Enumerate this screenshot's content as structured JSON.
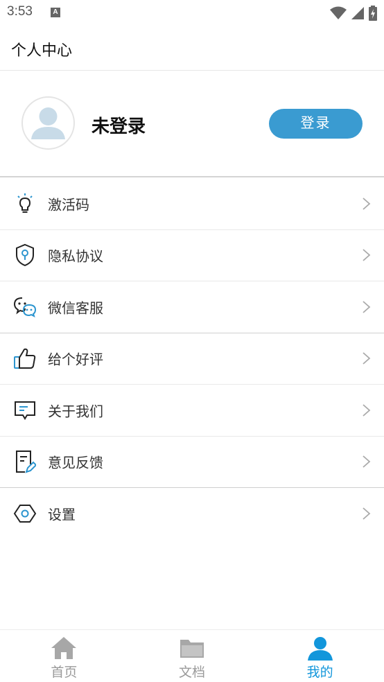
{
  "status_bar": {
    "time": "3:53",
    "notification_badge": "A"
  },
  "header": {
    "title": "个人中心"
  },
  "profile": {
    "status_text": "未登录",
    "login_label": "登录"
  },
  "menu": {
    "items": [
      {
        "label": "激活码",
        "icon": "lightbulb-icon"
      },
      {
        "label": "隐私协议",
        "icon": "shield-icon"
      },
      {
        "label": "微信客服",
        "icon": "wechat-icon"
      },
      {
        "label": "给个好评",
        "icon": "thumbs-up-icon"
      },
      {
        "label": "关于我们",
        "icon": "message-icon"
      },
      {
        "label": "意见反馈",
        "icon": "feedback-icon"
      },
      {
        "label": "设置",
        "icon": "settings-icon"
      }
    ]
  },
  "bottom_nav": {
    "tabs": [
      {
        "label": "首页",
        "icon": "home-icon",
        "active": false
      },
      {
        "label": "文档",
        "icon": "folder-icon",
        "active": false
      },
      {
        "label": "我的",
        "icon": "user-icon",
        "active": true
      }
    ]
  },
  "colors": {
    "accent": "#3a9bd1",
    "nav_active": "#1296db",
    "nav_inactive": "#9a9a9a"
  }
}
